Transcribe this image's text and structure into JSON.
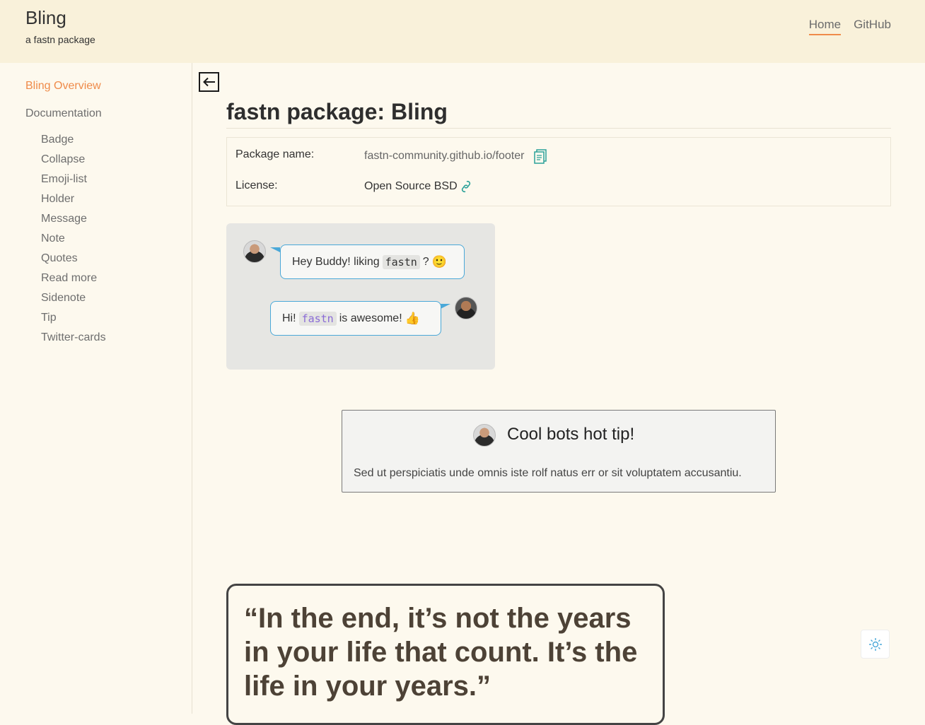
{
  "header": {
    "title": "Bling",
    "subtitle": "a fastn package",
    "nav": [
      {
        "label": "Home",
        "active": true
      },
      {
        "label": "GitHub",
        "active": false
      }
    ]
  },
  "sidebar": {
    "overview": "Bling Overview",
    "documentation": "Documentation",
    "items": [
      "Badge",
      "Collapse",
      "Emoji-list",
      "Holder",
      "Message",
      "Note",
      "Quotes",
      "Read more",
      "Sidenote",
      "Tip",
      "Twitter-cards"
    ]
  },
  "main": {
    "title": "fastn package: Bling",
    "package_label": "Package name:",
    "package_value": "fastn-community.github.io/footer",
    "license_label": "License:",
    "license_value": "Open Source BSD"
  },
  "chat": {
    "msg1_pre": "Hey Buddy! liking",
    "msg1_code": "fastn",
    "msg1_post": "?",
    "msg1_emoji": "🙂",
    "msg2_pre": "Hi!",
    "msg2_code": "fastn",
    "msg2_post": "is awesome!",
    "msg2_emoji": "👍"
  },
  "tip": {
    "title": "Cool bots hot tip!",
    "body": "Sed ut perspiciatis unde omnis iste rolf natus err or sit voluptatem accusantiu."
  },
  "quote": {
    "text": "“In the end, it’s not the years in your life that count. It’s the life in your years.”"
  },
  "colors": {
    "accent": "#ef8b4a",
    "header_bg": "#f9f1da",
    "page_bg": "#fdf9ee",
    "bubble_border": "#4aa8d8",
    "link_icon": "#2aa198"
  }
}
